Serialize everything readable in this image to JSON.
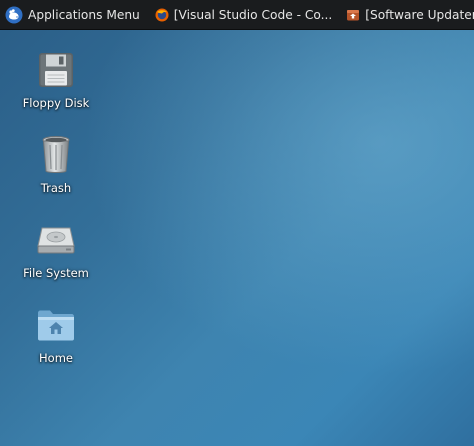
{
  "panel": {
    "apps_menu_label": "Applications Menu",
    "tasks": [
      {
        "label": "[Visual Studio Code - Co...",
        "icon": "firefox-icon"
      },
      {
        "label": "[Software Updater]",
        "icon": "software-updater-icon"
      }
    ]
  },
  "desktop": {
    "icons": [
      {
        "label": "Floppy Disk",
        "icon": "floppy-disk-icon"
      },
      {
        "label": "Trash",
        "icon": "trash-icon"
      },
      {
        "label": "File System",
        "icon": "hard-drive-icon"
      },
      {
        "label": "Home",
        "icon": "home-folder-icon"
      }
    ]
  },
  "colors": {
    "panel_bg": "#1a1c1e",
    "desktop_accent": "#3b86b6"
  }
}
